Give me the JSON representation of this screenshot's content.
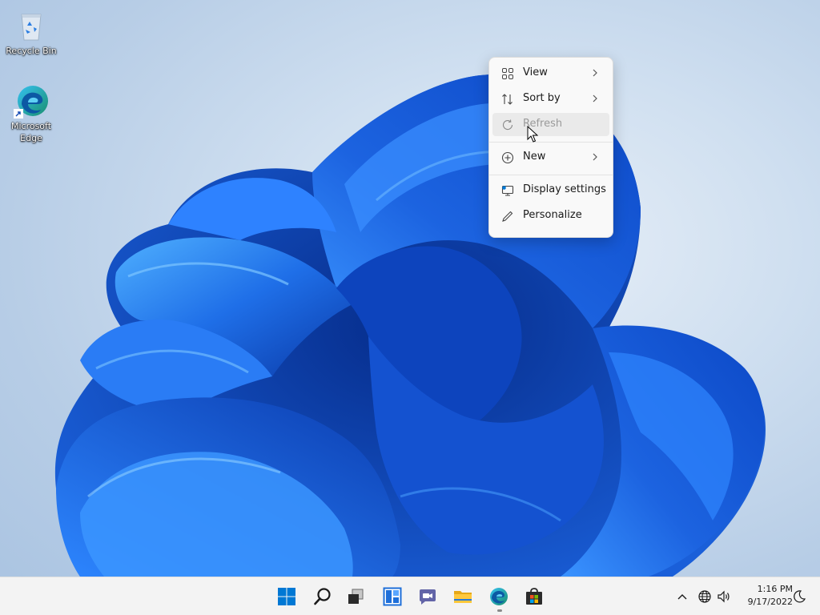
{
  "desktop": {
    "icons": [
      {
        "label": "Recycle Bin",
        "icon": "recycle-bin-icon"
      },
      {
        "label": "Microsoft Edge",
        "icon": "edge-icon"
      }
    ]
  },
  "context_menu": {
    "items": [
      {
        "label": "View",
        "icon": "view-grid-icon",
        "submenu": true
      },
      {
        "label": "Sort by",
        "icon": "sort-icon",
        "submenu": true
      },
      {
        "label": "Refresh",
        "icon": "refresh-icon",
        "disabled": true,
        "hovered": true
      },
      {
        "label": "New",
        "icon": "new-plus-icon",
        "submenu": true
      },
      {
        "label": "Display settings",
        "icon": "display-settings-icon"
      },
      {
        "label": "Personalize",
        "icon": "pen-icon"
      }
    ]
  },
  "taskbar": {
    "apps": [
      {
        "name": "Start",
        "icon": "windows-start-icon"
      },
      {
        "name": "Search",
        "icon": "search-icon"
      },
      {
        "name": "Task View",
        "icon": "task-view-icon"
      },
      {
        "name": "Widgets",
        "icon": "widgets-icon"
      },
      {
        "name": "Chat",
        "icon": "chat-icon"
      },
      {
        "name": "File Explorer",
        "icon": "folder-icon"
      },
      {
        "name": "Microsoft Edge",
        "icon": "edge-icon",
        "running": true
      },
      {
        "name": "Microsoft Store",
        "icon": "store-icon"
      }
    ],
    "tray": {
      "icons": [
        "chevron-up-icon",
        "network-globe-icon",
        "volume-icon"
      ],
      "time": "1:16 PM",
      "date": "9/17/2022",
      "notification_icon": "moon-icon"
    }
  },
  "colors": {
    "accent": "#0067c0",
    "bloom_dark": "#0a3fb5",
    "bloom_mid": "#1f6fe8",
    "bloom_light": "#3fa0ff",
    "menu_bg": "#f9f9f9",
    "taskbar_bg": "#f3f3f3"
  }
}
